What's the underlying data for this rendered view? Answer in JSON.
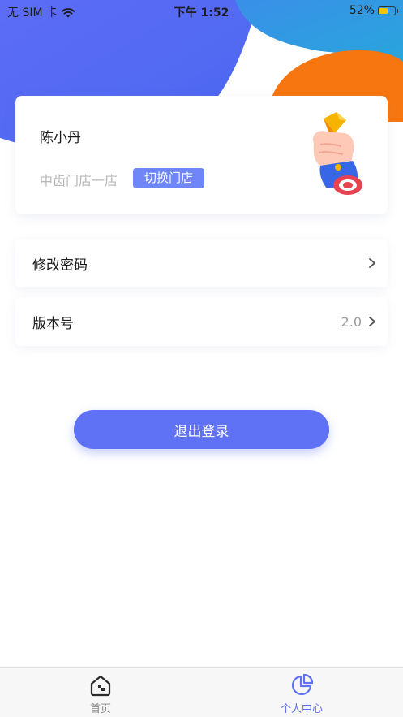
{
  "status_bar": {
    "carrier": "无 SIM 卡",
    "time": "下午 1:52",
    "battery_percent": "52%",
    "battery_level": 0.52
  },
  "profile": {
    "user_name": "陈小丹",
    "store_name": "中齿门店一店",
    "switch_store_label": "切换门店",
    "illustration_icon": "trophy-hand-icon"
  },
  "menu": {
    "change_password": {
      "label": "修改密码",
      "icon": "chevron-right-icon"
    },
    "version": {
      "label": "版本号",
      "value": "2.0",
      "icon": "chevron-right-icon"
    }
  },
  "logout_label": "退出登录",
  "tab_bar": {
    "tabs": [
      {
        "label": "首页",
        "icon": "home-icon",
        "active": false
      },
      {
        "label": "个人中心",
        "icon": "pie-chart-icon",
        "active": true
      }
    ]
  },
  "colors": {
    "accent": "#5f72f6",
    "header_blue": "#5b6ef5",
    "header_cyan": "#2f9fe0",
    "header_orange": "#f7760f"
  }
}
